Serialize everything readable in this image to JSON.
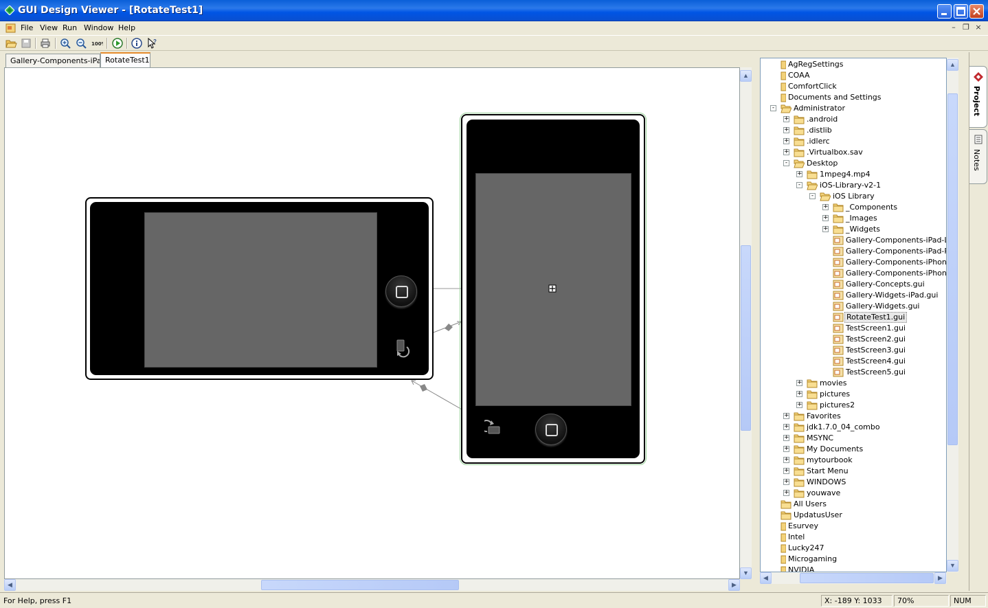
{
  "window": {
    "title": "GUI Design Viewer - [RotateTest1]"
  },
  "menu": [
    "File",
    "View",
    "Run",
    "Window",
    "Help"
  ],
  "tabs": [
    {
      "label": "Gallery-Components-iPad-L"
    },
    {
      "label": "RotateTest1"
    }
  ],
  "active_tab": 1,
  "tree": [
    {
      "label": "AgRegSettings",
      "depth": 0,
      "type": "folder-cut"
    },
    {
      "label": "COAA",
      "depth": 0,
      "type": "folder-cut"
    },
    {
      "label": "ComfortClick",
      "depth": 0,
      "type": "folder-cut"
    },
    {
      "label": "Documents and Settings",
      "depth": 0,
      "type": "folder-cut"
    },
    {
      "label": "Administrator",
      "depth": 1,
      "type": "folder-open",
      "expander": "-"
    },
    {
      "label": ".android",
      "depth": 2,
      "type": "folder",
      "expander": "+"
    },
    {
      "label": ".distlib",
      "depth": 2,
      "type": "folder",
      "expander": "+"
    },
    {
      "label": ".idlerc",
      "depth": 2,
      "type": "folder",
      "expander": "+"
    },
    {
      "label": ".Virtualbox.sav",
      "depth": 2,
      "type": "folder",
      "expander": "+"
    },
    {
      "label": "Desktop",
      "depth": 2,
      "type": "folder-open",
      "expander": "-"
    },
    {
      "label": "1mpeg4.mp4",
      "depth": 3,
      "type": "folder",
      "expander": "+"
    },
    {
      "label": "iOS-Library-v2-1",
      "depth": 3,
      "type": "folder-open",
      "expander": "-"
    },
    {
      "label": "iOS Library",
      "depth": 4,
      "type": "folder-open",
      "expander": "-"
    },
    {
      "label": "_Components",
      "depth": 5,
      "type": "folder",
      "expander": "+"
    },
    {
      "label": "_Images",
      "depth": 5,
      "type": "folder",
      "expander": "+"
    },
    {
      "label": "_Widgets",
      "depth": 5,
      "type": "folder",
      "expander": "+"
    },
    {
      "label": "Gallery-Components-iPad-L.gui",
      "depth": 5,
      "type": "gui"
    },
    {
      "label": "Gallery-Components-iPad-P.gui",
      "depth": 5,
      "type": "gui"
    },
    {
      "label": "Gallery-Components-iPhone-L.gui",
      "depth": 5,
      "type": "gui"
    },
    {
      "label": "Gallery-Components-iPhone-P.gui",
      "depth": 5,
      "type": "gui"
    },
    {
      "label": "Gallery-Concepts.gui",
      "depth": 5,
      "type": "gui"
    },
    {
      "label": "Gallery-Widgets-iPad.gui",
      "depth": 5,
      "type": "gui"
    },
    {
      "label": "Gallery-Widgets.gui",
      "depth": 5,
      "type": "gui"
    },
    {
      "label": "RotateTest1.gui",
      "depth": 5,
      "type": "gui",
      "selected": true
    },
    {
      "label": "TestScreen1.gui",
      "depth": 5,
      "type": "gui"
    },
    {
      "label": "TestScreen2.gui",
      "depth": 5,
      "type": "gui"
    },
    {
      "label": "TestScreen3.gui",
      "depth": 5,
      "type": "gui"
    },
    {
      "label": "TestScreen4.gui",
      "depth": 5,
      "type": "gui"
    },
    {
      "label": "TestScreen5.gui",
      "depth": 5,
      "type": "gui"
    },
    {
      "label": "movies",
      "depth": 3,
      "type": "folder",
      "expander": "+"
    },
    {
      "label": "pictures",
      "depth": 3,
      "type": "folder",
      "expander": "+"
    },
    {
      "label": "pictures2",
      "depth": 3,
      "type": "folder",
      "expander": "+"
    },
    {
      "label": "Favorites",
      "depth": 2,
      "type": "folder",
      "expander": "+"
    },
    {
      "label": "jdk1.7.0_04_combo",
      "depth": 2,
      "type": "folder",
      "expander": "+"
    },
    {
      "label": "MSYNC",
      "depth": 2,
      "type": "folder",
      "expander": "+"
    },
    {
      "label": "My Documents",
      "depth": 2,
      "type": "folder",
      "expander": "+"
    },
    {
      "label": "mytourbook",
      "depth": 2,
      "type": "folder",
      "expander": "+"
    },
    {
      "label": "Start Menu",
      "depth": 2,
      "type": "folder",
      "expander": "+"
    },
    {
      "label": "WINDOWS",
      "depth": 2,
      "type": "folder",
      "expander": "+"
    },
    {
      "label": "youwave",
      "depth": 2,
      "type": "folder",
      "expander": "+"
    },
    {
      "label": "All Users",
      "depth": 1,
      "type": "folder"
    },
    {
      "label": "UpdatusUser",
      "depth": 1,
      "type": "folder"
    },
    {
      "label": "Esurvey",
      "depth": 0,
      "type": "folder-cut"
    },
    {
      "label": "Intel",
      "depth": 0,
      "type": "folder-cut"
    },
    {
      "label": "Lucky247",
      "depth": 0,
      "type": "folder-cut"
    },
    {
      "label": "Microgaming",
      "depth": 0,
      "type": "folder-cut"
    },
    {
      "label": "NVIDIA",
      "depth": 0,
      "type": "folder-cut"
    }
  ],
  "side_tabs": {
    "project": "Project",
    "notes": "Notes"
  },
  "status": {
    "help": "For Help, press F1",
    "coords": "X: -189  Y: 1033",
    "zoom": "70%",
    "num": "NUM"
  },
  "colors": {
    "title_bar": "#0a5fd8",
    "canvas": "#ffffff",
    "screen_gray": "#666666",
    "device_bezel": "#000000",
    "tab_accent": "#e68b2c"
  }
}
